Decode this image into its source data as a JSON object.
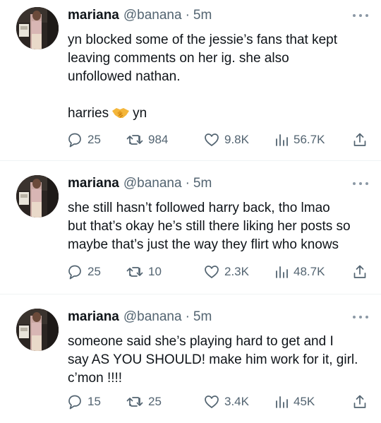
{
  "tweets": [
    {
      "name": "mariana",
      "handle": "@banana",
      "time": "5m",
      "lines": [
        "yn blocked some of the jessie’s fans that kept",
        "leaving comments on her ig. she also",
        "unfollowed nathan."
      ],
      "extra_left": "harries",
      "extra_emoji": "handshake-emoji",
      "extra_right": "yn",
      "replies": "25",
      "retweets": "984",
      "likes": "9.8K",
      "views": "56.7K"
    },
    {
      "name": "mariana",
      "handle": "@banana",
      "time": "5m",
      "lines": [
        "she still hasn’t followed harry back, tho lmao",
        "but that’s okay he’s still there liking her posts so",
        "maybe that’s just the way they flirt who knows"
      ],
      "replies": "25",
      "retweets": "10",
      "likes": "2.3K",
      "views": "48.7K"
    },
    {
      "name": "mariana",
      "handle": "@banana",
      "time": "5m",
      "lines": [
        "someone said she’s playing hard to get and I",
        "say AS YOU SHOULD! make him work for it, girl.",
        "c’mon !!!!"
      ],
      "replies": "15",
      "retweets": "25",
      "likes": "3.4K",
      "views": "45K"
    }
  ],
  "icons": {
    "reply": "reply-icon",
    "retweet": "retweet-icon",
    "like": "heart-icon",
    "views": "views-icon",
    "share": "share-icon",
    "more": "more-icon"
  },
  "colors": {
    "text": "#0f1419",
    "secondary": "#536471",
    "divider": "#eff3f4"
  }
}
